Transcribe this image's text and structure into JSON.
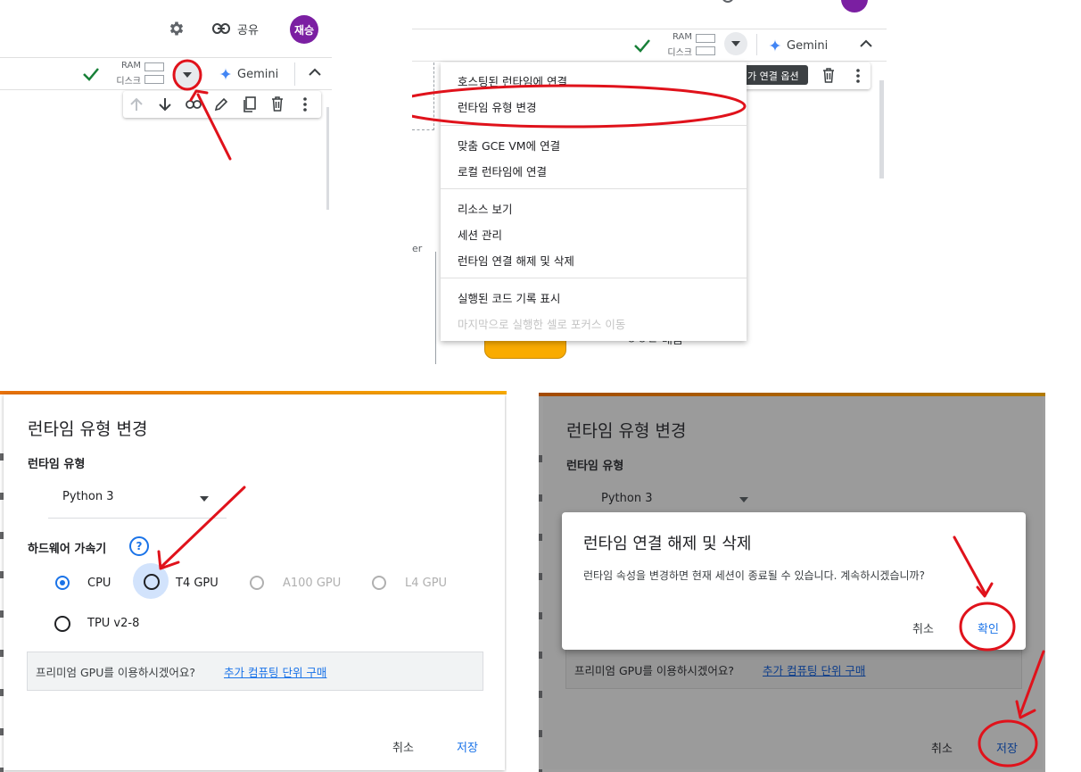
{
  "panel1": {
    "share_label": "공유",
    "avatar_text": "재승",
    "ram_label": "RAM",
    "disk_label": "디스크",
    "gemini_label": "Gemini"
  },
  "panel2": {
    "ram_label": "RAM",
    "disk_label": "디스크",
    "gemini_label": "Gemini",
    "tooltip": "가 연결 옵션",
    "side_letters": "er",
    "bg_text": "ㅇㅇㄷ 배움",
    "menu_items": [
      {
        "label": "호스팅된 런타임에 연결",
        "enabled": true
      },
      {
        "label": "런타임 유형 변경",
        "enabled": true
      },
      {
        "label": "맞춤 GCE VM에 연결",
        "enabled": true
      },
      {
        "label": "로컬 런타임에 연결",
        "enabled": true
      },
      {
        "label": "리소스 보기",
        "enabled": true
      },
      {
        "label": "세션 관리",
        "enabled": true
      },
      {
        "label": "런타임 연결 해제 및 삭제",
        "enabled": true
      },
      {
        "label": "실행된 코드 기록 표시",
        "enabled": true
      },
      {
        "label": "마지막으로 실행한 셀로 포커스 이동",
        "enabled": false
      }
    ]
  },
  "dialog": {
    "title": "런타임 유형 변경",
    "runtime_type_label": "런타임 유형",
    "runtime_value": "Python 3",
    "hw_label": "하드웨어 가속기",
    "help_icon": "?",
    "accelerators": [
      {
        "label": "CPU",
        "selected": true,
        "disabled": false
      },
      {
        "label": "T4 GPU",
        "selected": false,
        "disabled": false
      },
      {
        "label": "A100 GPU",
        "selected": false,
        "disabled": true
      },
      {
        "label": "L4 GPU",
        "selected": false,
        "disabled": true
      },
      {
        "label": "TPU v2-8",
        "selected": false,
        "disabled": false
      }
    ],
    "premium_text": "프리미엄 GPU를 이용하시겠어요?",
    "premium_link": "추가 컴퓨팅 단위 구매",
    "cancel_label": "취소",
    "save_label": "저장"
  },
  "confirm": {
    "title": "런타임 연결 해제 및 삭제",
    "message": "런타임 속성을 변경하면 현재 세션이 종료될 수 있습니다. 계속하시겠습니까?",
    "cancel_label": "취소",
    "ok_label": "확인"
  },
  "colors": {
    "accent": "#1a73e8",
    "avatar": "#7b1fa2",
    "check": "#188038",
    "annotation": "#e0121b",
    "colab_bar_left": "#e8710a",
    "colab_bar_right": "#f9ab00"
  }
}
